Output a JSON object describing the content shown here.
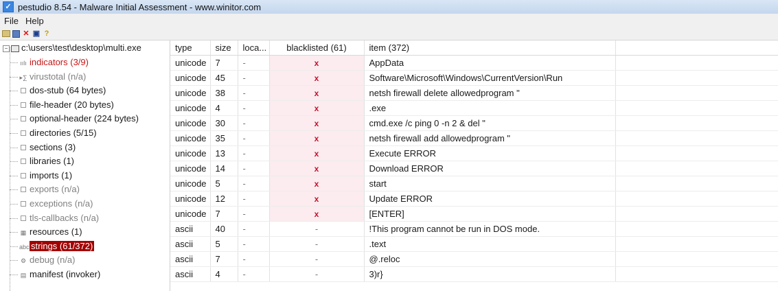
{
  "window": {
    "title": "pestudio 8.54 - Malware Initial Assessment - www.winitor.com",
    "accent": "#3a86e0"
  },
  "menu": {
    "items": [
      "File",
      "Help"
    ]
  },
  "toolbar": {
    "icons": [
      "open-icon",
      "save-icon",
      "close-x-icon",
      "disk-icon",
      "help-icon"
    ]
  },
  "tree": {
    "root": "c:\\users\\test\\desktop\\multi.exe",
    "nodes": [
      {
        "label": "indicators (3/9)",
        "style": "red",
        "icon": "indicators-icon",
        "glyph": "ıılı"
      },
      {
        "label": "virustotal (n/a)",
        "style": "grey",
        "icon": "virustotal-icon",
        "glyph": "▸∑"
      },
      {
        "label": "dos-stub (64 bytes)",
        "style": "normal",
        "icon": "box"
      },
      {
        "label": "file-header (20 bytes)",
        "style": "normal",
        "icon": "box"
      },
      {
        "label": "optional-header (224 bytes)",
        "style": "normal",
        "icon": "box"
      },
      {
        "label": "directories (5/15)",
        "style": "normal",
        "icon": "box"
      },
      {
        "label": "sections (3)",
        "style": "normal",
        "icon": "box"
      },
      {
        "label": "libraries (1)",
        "style": "normal",
        "icon": "box"
      },
      {
        "label": "imports (1)",
        "style": "normal",
        "icon": "box"
      },
      {
        "label": "exports (n/a)",
        "style": "grey",
        "icon": "box"
      },
      {
        "label": "exceptions (n/a)",
        "style": "grey",
        "icon": "box"
      },
      {
        "label": "tls-callbacks (n/a)",
        "style": "grey",
        "icon": "box"
      },
      {
        "label": "resources (1)",
        "style": "normal",
        "icon": "resources-icon",
        "glyph": "▦"
      },
      {
        "label": "strings (61/372)",
        "style": "selected",
        "icon": "strings-icon",
        "glyph": "abc"
      },
      {
        "label": "debug (n/a)",
        "style": "grey",
        "icon": "debug-icon",
        "glyph": "⚙"
      },
      {
        "label": "manifest (invoker)",
        "style": "normal",
        "icon": "manifest-icon",
        "glyph": "▤"
      }
    ]
  },
  "grid": {
    "columns": [
      "type",
      "size",
      "loca...",
      "blacklisted (61)",
      "item (372)",
      ""
    ],
    "rows": [
      {
        "type": "unicode",
        "size": "7",
        "location": "-",
        "blacklisted": "x",
        "item": "AppData"
      },
      {
        "type": "unicode",
        "size": "45",
        "location": "-",
        "blacklisted": "x",
        "item": "Software\\Microsoft\\Windows\\CurrentVersion\\Run"
      },
      {
        "type": "unicode",
        "size": "38",
        "location": "-",
        "blacklisted": "x",
        "item": "netsh firewall delete allowedprogram \""
      },
      {
        "type": "unicode",
        "size": "4",
        "location": "-",
        "blacklisted": "x",
        "item": ".exe"
      },
      {
        "type": "unicode",
        "size": "30",
        "location": "-",
        "blacklisted": "x",
        "item": "cmd.exe /c ping 0 -n 2 & del \""
      },
      {
        "type": "unicode",
        "size": "35",
        "location": "-",
        "blacklisted": "x",
        "item": "netsh firewall add allowedprogram \""
      },
      {
        "type": "unicode",
        "size": "13",
        "location": "-",
        "blacklisted": "x",
        "item": "Execute ERROR"
      },
      {
        "type": "unicode",
        "size": "14",
        "location": "-",
        "blacklisted": "x",
        "item": "Download ERROR"
      },
      {
        "type": "unicode",
        "size": "5",
        "location": "-",
        "blacklisted": "x",
        "item": "start"
      },
      {
        "type": "unicode",
        "size": "12",
        "location": "-",
        "blacklisted": "x",
        "item": "Update ERROR"
      },
      {
        "type": "unicode",
        "size": "7",
        "location": "-",
        "blacklisted": "x",
        "item": "[ENTER]"
      },
      {
        "type": "ascii",
        "size": "40",
        "location": "-",
        "blacklisted": "-",
        "item": "!This program cannot be run in DOS mode."
      },
      {
        "type": "ascii",
        "size": "5",
        "location": "-",
        "blacklisted": "-",
        "item": ".text"
      },
      {
        "type": "ascii",
        "size": "7",
        "location": "-",
        "blacklisted": "-",
        "item": "@.reloc"
      },
      {
        "type": "ascii",
        "size": "4",
        "location": "-",
        "blacklisted": "-",
        "item": "3)r}"
      }
    ]
  }
}
